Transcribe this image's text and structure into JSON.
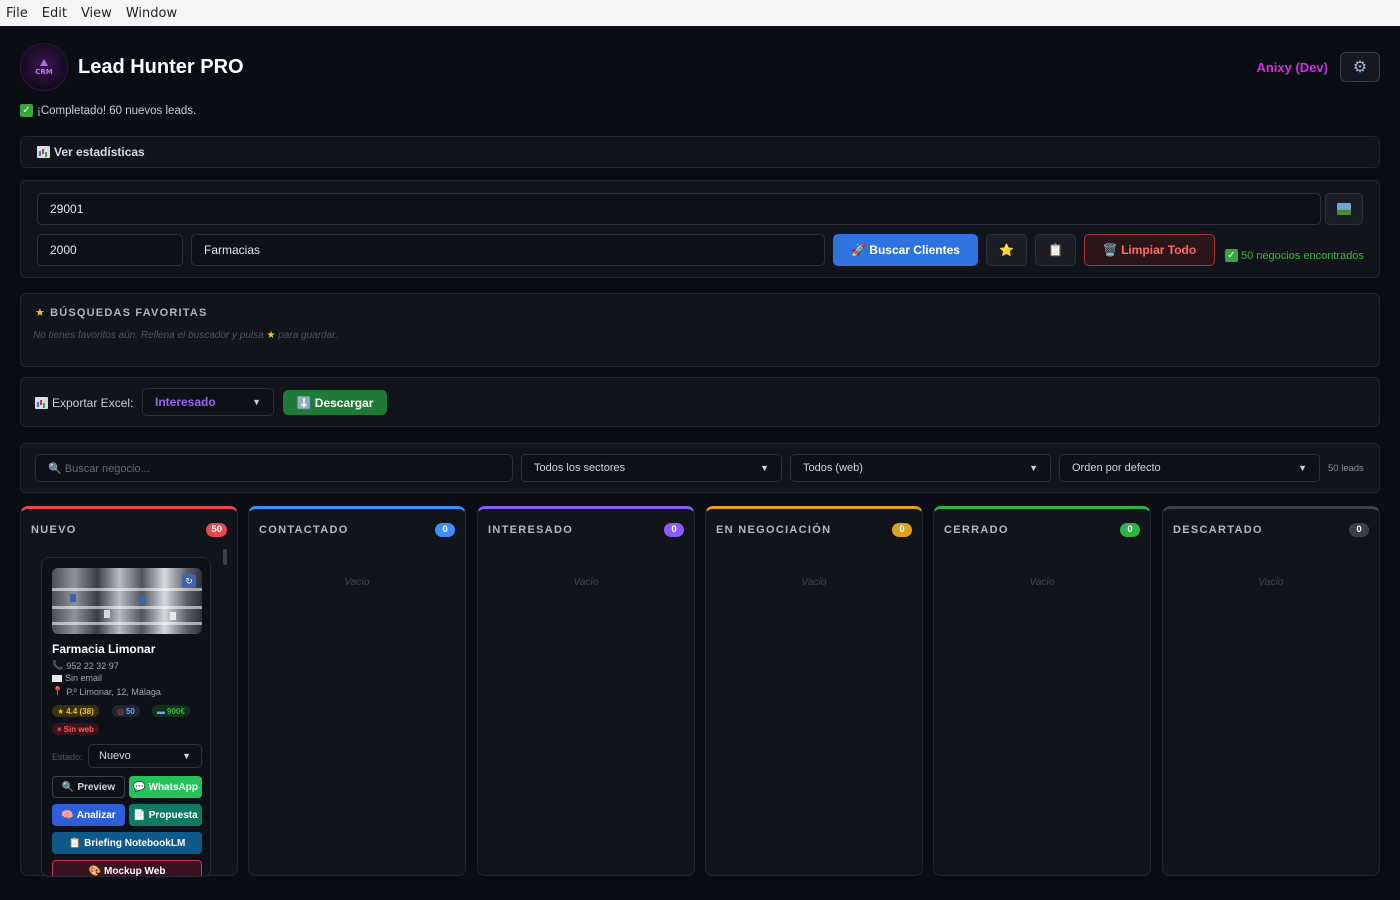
{
  "menu": [
    "File",
    "Edit",
    "View",
    "Window"
  ],
  "app": {
    "logo_text": "CRM",
    "title": "Lead Hunter PRO",
    "user": "Anixy (Dev)"
  },
  "status": {
    "message": "¡Completado! 60 nuevos leads."
  },
  "stats": {
    "label": "Ver estadísticas"
  },
  "search": {
    "location_value": "29001",
    "radius_value": "2000",
    "sector_value": "Farmacias",
    "search_button": "🚀 Buscar Clientes",
    "favorite_button": "⭐",
    "clipboard_button": "📋",
    "clear_button": "🗑️ Limpiar Todo",
    "found_text": "50 negocios encontrados"
  },
  "favorites": {
    "title": "BÚSQUEDAS FAVORITAS",
    "empty_prefix": "No tienes favoritos aún. Rellena el buscador y pulsa",
    "empty_suffix": "para guardar."
  },
  "export": {
    "label": "Exportar Excel:",
    "selected": "Interesado",
    "download_button": "⬇️ Descargar"
  },
  "filters": {
    "search_placeholder": "🔍 Buscar negocio...",
    "sector": "Todos los sectores",
    "web": "Todos (web)",
    "order": "Orden por defecto",
    "leads_count": "50 leads"
  },
  "columns": [
    {
      "title": "NUEVO",
      "count": "50",
      "color": "#e5484d"
    },
    {
      "title": "CONTACTADO",
      "count": "0",
      "color": "#3e8ef7"
    },
    {
      "title": "INTERESADO",
      "count": "0",
      "color": "#8b5cf6"
    },
    {
      "title": "EN NEGOCIACIÓN",
      "count": "0",
      "color": "#e0a020"
    },
    {
      "title": "CERRADO",
      "count": "0",
      "color": "#2fb344"
    },
    {
      "title": "DESCARTADO",
      "count": "0",
      "color": "#3a3f4b"
    }
  ],
  "empty_label": "Vacío",
  "card": {
    "name": "Farmacia Limonar",
    "phone": "952 22 32 97",
    "email": "Sin email",
    "address": "P.º Limonar, 12, Málaga",
    "rating": "4.4 (38)",
    "score": "50",
    "value": "900€",
    "web": "Sin web",
    "estado_label": "Estado:",
    "estado_value": "Nuevo",
    "buttons": {
      "preview": "Preview",
      "whatsapp": "WhatsApp",
      "analizar": "Analizar",
      "propuesta": "Propuesta",
      "briefing": "Briefing NotebookLM",
      "more": "Mockup Web"
    }
  }
}
